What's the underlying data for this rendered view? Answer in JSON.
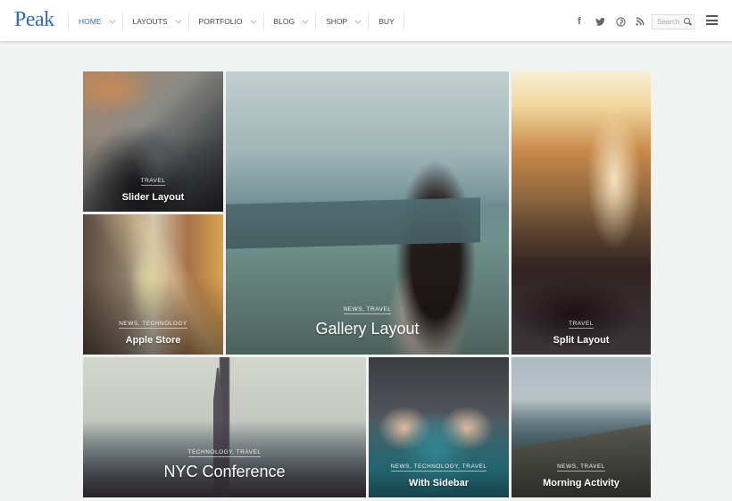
{
  "header": {
    "logo": "Peak",
    "nav": [
      {
        "label": "Home",
        "has_dropdown": true,
        "active": true
      },
      {
        "label": "Layouts",
        "has_dropdown": true,
        "active": false
      },
      {
        "label": "Portfolio",
        "has_dropdown": true,
        "active": false
      },
      {
        "label": "Blog",
        "has_dropdown": true,
        "active": false
      },
      {
        "label": "Shop",
        "has_dropdown": true,
        "active": false
      },
      {
        "label": "Buy",
        "has_dropdown": false,
        "active": false
      }
    ],
    "social": [
      {
        "name": "facebook-icon",
        "glyph": "f"
      },
      {
        "name": "twitter-icon",
        "glyph": "🐦"
      },
      {
        "name": "pinterest-icon",
        "glyph": "℗"
      },
      {
        "name": "rss-icon",
        "glyph": "⌇"
      }
    ],
    "search": {
      "placeholder": "Search",
      "value": ""
    },
    "menu_icon": "hamburger-icon"
  },
  "colors": {
    "accent": "#2f6eb3",
    "background": "#f1f2f2"
  },
  "posts": [
    {
      "id": "slider",
      "categories": "Travel",
      "title": "Slider Layout"
    },
    {
      "id": "apple",
      "categories": "News, Technology",
      "title": "Apple Store"
    },
    {
      "id": "gallery",
      "categories": "News, Travel",
      "title": "Gallery Layout"
    },
    {
      "id": "split",
      "categories": "Travel",
      "title": "Split Layout"
    },
    {
      "id": "nyc",
      "categories": "Technology, Travel",
      "title": "NYC Conference"
    },
    {
      "id": "sidebar",
      "categories": "News, Technology, Travel",
      "title": "With Sidebar"
    },
    {
      "id": "morning",
      "categories": "News, Travel",
      "title": "Morning Activity"
    }
  ]
}
